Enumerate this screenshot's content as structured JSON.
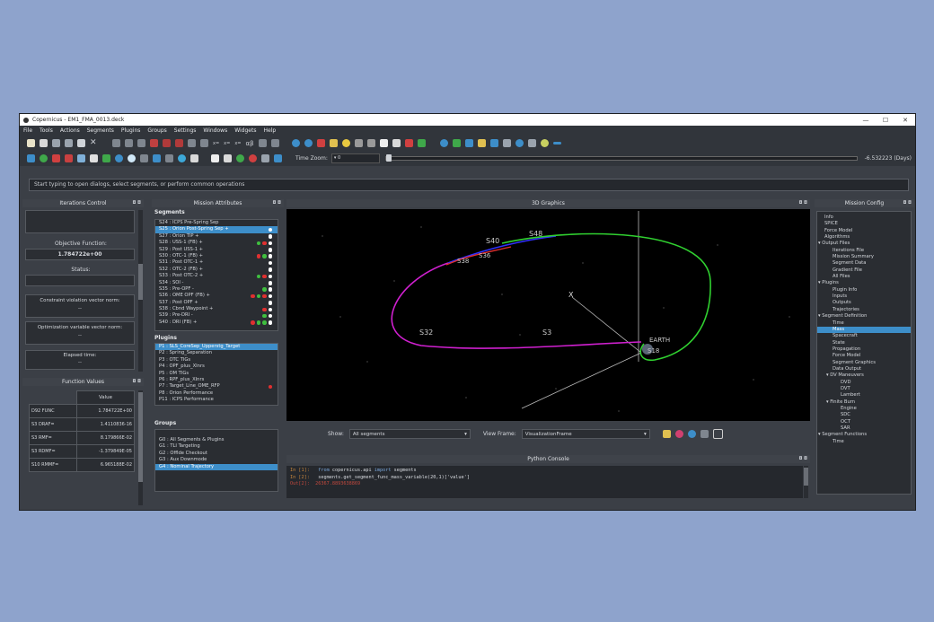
{
  "window": {
    "title": "Copernicus - EM1_FMA_0013.deck"
  },
  "menu": [
    "File",
    "Tools",
    "Actions",
    "Segments",
    "Plugins",
    "Groups",
    "Settings",
    "Windows",
    "Widgets",
    "Help"
  ],
  "toolbar2": {
    "time_zoom_label": "Time Zoom:",
    "time_zoom_value": "0",
    "time_value": "-6.532223 (Days)"
  },
  "toolbar_text": [
    "x=",
    "x=",
    "x=",
    "αβ"
  ],
  "command_placeholder": "Start typing to open dialogs, select segments, or perform common operations",
  "iterations": {
    "title": "Iterations Control",
    "objective_label": "Objective Function:",
    "objective_value": "1.784722e+00",
    "status_label": "Status:",
    "status_value": "",
    "constraint_label": "Constraint violation vector norm:",
    "constraint_value": "--",
    "optimization_label": "Optimization variable vector norm:",
    "optimization_value": "--",
    "elapsed_label": "Elapsed time:",
    "elapsed_value": "--"
  },
  "function_values": {
    "title": "Function Values",
    "header": "Value",
    "rows": [
      {
        "name": "D92 FUNC",
        "value": "1.784722E+00"
      },
      {
        "name": "S3 DRAF=",
        "value": "1.4110836-16"
      },
      {
        "name": "S3 RMF=",
        "value": "8.179866E-02"
      },
      {
        "name": "S3 RDMF=",
        "value": "-1.379849E-05"
      },
      {
        "name": "S10 RMMF=",
        "value": "6.965188E-02"
      }
    ]
  },
  "mission_attributes": {
    "title": "Mission Attributes",
    "segments_label": "Segments",
    "segments": [
      {
        "label": "S24 : ICPS Pre-Spring Sep",
        "dots": []
      },
      {
        "label": "S25 : Orion Post-Spring Sep +",
        "dots": [
          "#ffffff"
        ],
        "selected": true
      },
      {
        "label": "S27 : Orion TIP +",
        "dots": [
          "#ffffff"
        ]
      },
      {
        "label": "S28 : USS-1 (FB) +",
        "dots": [
          "#3fbf3f",
          "#e03030",
          "#ffffff"
        ]
      },
      {
        "label": "S29 : Post USS-1 +",
        "dots": [
          "#ffffff"
        ]
      },
      {
        "label": "S30 : OTC-1 (FB) +",
        "dots": [
          "#e03030",
          "#3fbf3f",
          "#ffffff"
        ]
      },
      {
        "label": "S31 : Post OTC-1 +",
        "dots": [
          "#ffffff"
        ]
      },
      {
        "label": "S32 : OTC-2 (FB) +",
        "dots": [
          "#ffffff"
        ]
      },
      {
        "label": "S33 : Post OTC-2 +",
        "dots": [
          "#3fbf3f",
          "#e03030",
          "#ffffff"
        ]
      },
      {
        "label": "S34 : SOI -",
        "dots": [
          "#ffffff"
        ]
      },
      {
        "label": "S35 : Pre-OPF -",
        "dots": [
          "#3fbf3f",
          "#ffffff"
        ]
      },
      {
        "label": "S36 : OME OPF (FB) +",
        "dots": [
          "#e03030",
          "#3fbf3f",
          "#e03030",
          "#ffffff"
        ]
      },
      {
        "label": "S37 : Post OPF +",
        "dots": [
          "#ffffff"
        ]
      },
      {
        "label": "S38 : Cbnd Waypoint +",
        "dots": [
          "#e03030",
          "#ffffff"
        ]
      },
      {
        "label": "S39 : Pre-DRI -",
        "dots": [
          "#3fbf3f",
          "#ffffff"
        ]
      },
      {
        "label": "S40 : DRI (FB) +",
        "dots": [
          "#e03030",
          "#3fbf3f",
          "#3fbf3f",
          "#ffffff"
        ]
      }
    ],
    "plugins_label": "Plugins",
    "plugins": [
      {
        "label": "P1 : SLS_CoreSep_Upperstg_Target",
        "selected": true
      },
      {
        "label": "P2 : Spring_Separation"
      },
      {
        "label": "P3 : OTC TIGs"
      },
      {
        "label": "P4 : OPF_plus_XInrs"
      },
      {
        "label": "P5 : OM TIGs"
      },
      {
        "label": "P6 : RPF_plus_XInrs"
      },
      {
        "label": "P7 : Target_Line_OME_RFP",
        "dots": [
          "#e03030"
        ]
      },
      {
        "label": "P8 : Orion Performance"
      },
      {
        "label": "P11 : ICPS Performance"
      }
    ],
    "groups_label": "Groups",
    "groups": [
      {
        "label": "G0 : All Segments & Plugins"
      },
      {
        "label": "G1 : TLI Targeting"
      },
      {
        "label": "G2 : Offlde Checkout"
      },
      {
        "label": "G3 : Aux Downmode"
      },
      {
        "label": "G4 : Nominal Trajectory",
        "selected": true
      }
    ]
  },
  "graphics": {
    "title": "3D Graphics",
    "show_label": "Show:",
    "show_value": "All segments",
    "frame_label": "View Frame:",
    "frame_value": "VisualizationFrame",
    "labels": [
      "S40",
      "S38",
      "S36",
      "S32",
      "S18",
      "S3",
      "EARTH",
      "S48"
    ],
    "axis_labels": [
      "X"
    ]
  },
  "console": {
    "title": "Python Console",
    "lines": [
      {
        "prompt": "In [1]:",
        "code_kw": "from",
        "code_rest1": " copernicus.api ",
        "code_kw2": "import",
        "code_rest2": " segments"
      },
      {
        "prompt": "In [2]:",
        "code": "segments.get_segment_func_mass_variable(20,1)['value']"
      },
      {
        "prompt": "Out[2]:",
        "code": "26367.8893638869"
      }
    ]
  },
  "mission_config": {
    "title": "Mission Config",
    "tree": [
      {
        "label": "Info",
        "level": 0
      },
      {
        "label": "SPICE",
        "level": 0
      },
      {
        "label": "Force Model",
        "level": 0
      },
      {
        "label": "Algorithms",
        "level": 0
      },
      {
        "label": "Output Files",
        "level": 0,
        "expanded": true
      },
      {
        "label": "Iterations File",
        "level": 1
      },
      {
        "label": "Mission Summary",
        "level": 1
      },
      {
        "label": "Segment Data",
        "level": 1
      },
      {
        "label": "Gradient File",
        "level": 1
      },
      {
        "label": "All Files",
        "level": 1
      },
      {
        "label": "Plugins",
        "level": 0,
        "expanded": true
      },
      {
        "label": "Plugin Info",
        "level": 1
      },
      {
        "label": "Inputs",
        "level": 1
      },
      {
        "label": "Outputs",
        "level": 1
      },
      {
        "label": "Trajectories",
        "level": 1
      },
      {
        "label": "Segment Definition",
        "level": 0,
        "expanded": true
      },
      {
        "label": "Time",
        "level": 1
      },
      {
        "label": "Mass",
        "level": 1,
        "selected": true
      },
      {
        "label": "Spacecraft",
        "level": 1
      },
      {
        "label": "State",
        "level": 1
      },
      {
        "label": "Propagation",
        "level": 1
      },
      {
        "label": "Force Model",
        "level": 1
      },
      {
        "label": "Segment Graphics",
        "level": 1
      },
      {
        "label": "Data Output",
        "level": 1
      },
      {
        "label": "DV Maneuvers",
        "level": 1,
        "expanded": true
      },
      {
        "label": "DVD",
        "level": 2
      },
      {
        "label": "DVT",
        "level": 2
      },
      {
        "label": "Lambert",
        "level": 2
      },
      {
        "label": "Finite Burn",
        "level": 1,
        "expanded": true
      },
      {
        "label": "Engine",
        "level": 2
      },
      {
        "label": "SDC",
        "level": 2
      },
      {
        "label": "OCT",
        "level": 2
      },
      {
        "label": "SAR",
        "level": 2
      },
      {
        "label": "Segment Functions",
        "level": 0,
        "expanded": true
      },
      {
        "label": "Time",
        "level": 1
      }
    ]
  }
}
